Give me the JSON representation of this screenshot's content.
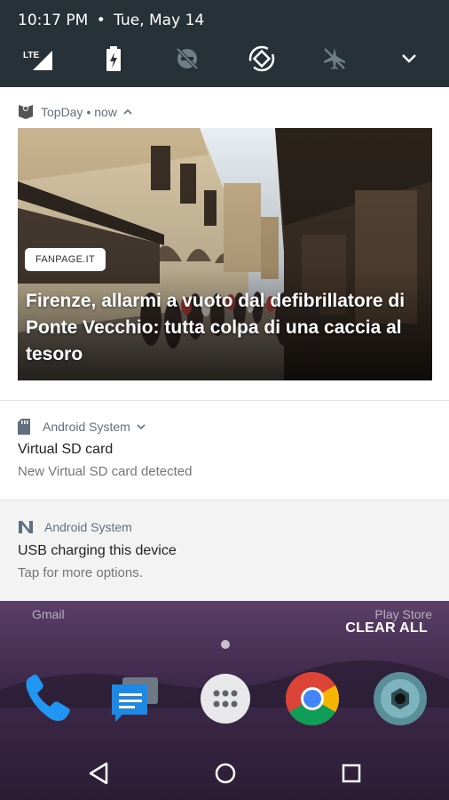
{
  "status": {
    "time": "10:17 PM",
    "separator": "•",
    "date": "Tue, May 14"
  },
  "quick_settings": {
    "icons": [
      "lte-signal-icon",
      "battery-charging-icon",
      "do-not-disturb-off-icon",
      "auto-rotate-icon",
      "airplane-mode-icon",
      "expand-chevron-icon"
    ]
  },
  "notifications": [
    {
      "app": "TopDay",
      "meta": "• now",
      "source_badge": "FANPAGE.IT",
      "headline": "Firenze, allarmi a vuoto dal defibrillatore di Ponte Vecchio: tutta colpa di una caccia al tesoro"
    },
    {
      "app": "Android System",
      "title": "Virtual SD card",
      "text": "New Virtual SD card detected"
    },
    {
      "app": "Android System",
      "title": "USB charging this device",
      "text": "Tap for more options."
    }
  ],
  "home": {
    "label_left": "Gmail",
    "label_right": "Play Store",
    "clear_all": "CLEAR ALL",
    "dock": [
      "phone-icon",
      "messages-icon",
      "app-drawer-icon",
      "chrome-icon",
      "camera-icon"
    ]
  },
  "navbar": [
    "back-icon",
    "home-icon",
    "recents-icon"
  ],
  "colors": {
    "qs_bg": "#263238",
    "panel_bg": "#ffffff",
    "accent": "#607080"
  }
}
